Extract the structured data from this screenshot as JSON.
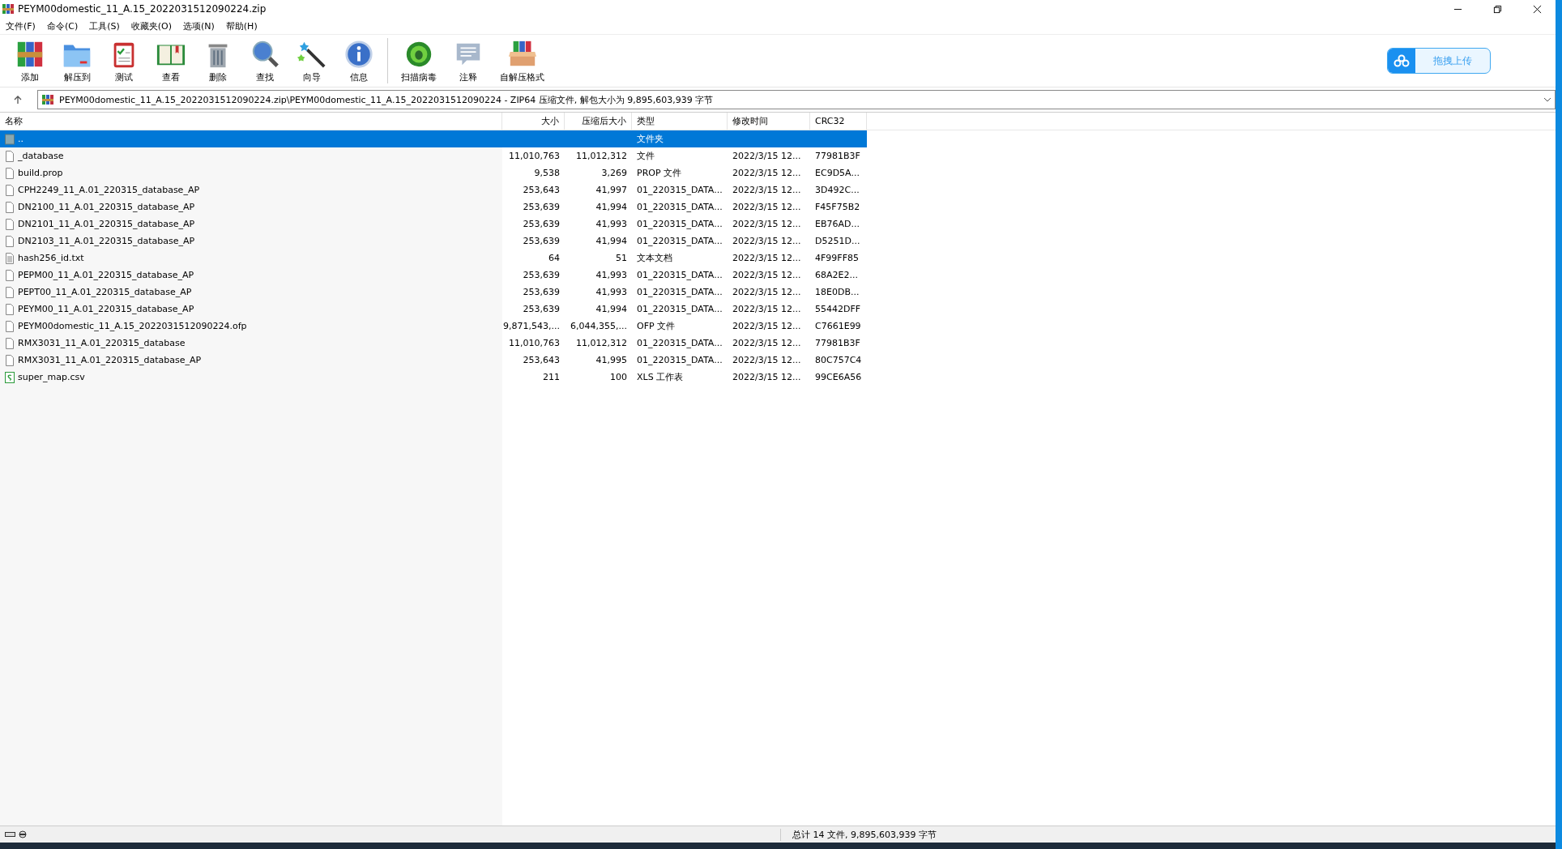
{
  "window": {
    "title": "PEYM00domestic_11_A.15_2022031512090224.zip"
  },
  "menu": [
    "文件(F)",
    "命令(C)",
    "工具(S)",
    "收藏夹(O)",
    "选项(N)",
    "帮助(H)"
  ],
  "toolbar": [
    {
      "label": "添加",
      "kind": "add"
    },
    {
      "label": "解压到",
      "kind": "extract"
    },
    {
      "label": "测试",
      "kind": "test"
    },
    {
      "label": "查看",
      "kind": "view"
    },
    {
      "label": "删除",
      "kind": "delete"
    },
    {
      "label": "查找",
      "kind": "find"
    },
    {
      "label": "向导",
      "kind": "wizard"
    },
    {
      "label": "信息",
      "kind": "info"
    },
    {
      "label": "扫描病毒",
      "kind": "scan",
      "separator_before": true
    },
    {
      "label": "注释",
      "kind": "comment"
    },
    {
      "label": "自解压格式",
      "kind": "sfx"
    }
  ],
  "upload_button": {
    "label": "拖拽上传"
  },
  "address": {
    "path": "PEYM00domestic_11_A.15_2022031512090224.zip\\PEYM00domestic_11_A.15_2022031512090224 - ZIP64 压缩文件, 解包大小为 9,895,603,939 字节"
  },
  "table": {
    "columns": [
      "名称",
      "大小",
      "压缩后大小",
      "类型",
      "修改时间",
      "CRC32"
    ],
    "rows": [
      {
        "kind": "parent",
        "name": "..",
        "size": "",
        "packed": "",
        "type": "文件夹",
        "modified": "",
        "crc": "",
        "selected": true
      },
      {
        "kind": "file",
        "name": "_database",
        "size": "11,010,763",
        "packed": "11,012,312",
        "type": "文件",
        "modified": "2022/3/15 12...",
        "crc": "77981B3F",
        "selected": false
      },
      {
        "kind": "file",
        "name": "build.prop",
        "size": "9,538",
        "packed": "3,269",
        "type": "PROP 文件",
        "modified": "2022/3/15 12...",
        "crc": "EC9D5A...",
        "selected": false
      },
      {
        "kind": "file",
        "name": "CPH2249_11_A.01_220315_database_AP",
        "size": "253,643",
        "packed": "41,997",
        "type": "01_220315_DATA...",
        "modified": "2022/3/15 12...",
        "crc": "3D492C...",
        "selected": false
      },
      {
        "kind": "file",
        "name": "DN2100_11_A.01_220315_database_AP",
        "size": "253,639",
        "packed": "41,994",
        "type": "01_220315_DATA...",
        "modified": "2022/3/15 12...",
        "crc": "F45F75B2",
        "selected": false
      },
      {
        "kind": "file",
        "name": "DN2101_11_A.01_220315_database_AP",
        "size": "253,639",
        "packed": "41,993",
        "type": "01_220315_DATA...",
        "modified": "2022/3/15 12...",
        "crc": "EB76AD...",
        "selected": false
      },
      {
        "kind": "file",
        "name": "DN2103_11_A.01_220315_database_AP",
        "size": "253,639",
        "packed": "41,994",
        "type": "01_220315_DATA...",
        "modified": "2022/3/15 12...",
        "crc": "D5251D...",
        "selected": false
      },
      {
        "kind": "text",
        "name": "hash256_id.txt",
        "size": "64",
        "packed": "51",
        "type": "文本文档",
        "modified": "2022/3/15 12...",
        "crc": "4F99FF85",
        "selected": false
      },
      {
        "kind": "file",
        "name": "PEPM00_11_A.01_220315_database_AP",
        "size": "253,639",
        "packed": "41,993",
        "type": "01_220315_DATA...",
        "modified": "2022/3/15 12...",
        "crc": "68A2E2...",
        "selected": false
      },
      {
        "kind": "file",
        "name": "PEPT00_11_A.01_220315_database_AP",
        "size": "253,639",
        "packed": "41,993",
        "type": "01_220315_DATA...",
        "modified": "2022/3/15 12...",
        "crc": "18E0DB...",
        "selected": false
      },
      {
        "kind": "file",
        "name": "PEYM00_11_A.01_220315_database_AP",
        "size": "253,639",
        "packed": "41,994",
        "type": "01_220315_DATA...",
        "modified": "2022/3/15 12...",
        "crc": "55442DFF",
        "selected": false
      },
      {
        "kind": "file",
        "name": "PEYM00domestic_11_A.15_2022031512090224.ofp",
        "size": "9,871,543,...",
        "packed": "6,044,355,...",
        "type": "OFP 文件",
        "modified": "2022/3/15 12...",
        "crc": "C7661E99",
        "selected": false
      },
      {
        "kind": "file",
        "name": "RMX3031_11_A.01_220315_database",
        "size": "11,010,763",
        "packed": "11,012,312",
        "type": "01_220315_DATA...",
        "modified": "2022/3/15 12...",
        "crc": "77981B3F",
        "selected": false
      },
      {
        "kind": "file",
        "name": "RMX3031_11_A.01_220315_database_AP",
        "size": "253,643",
        "packed": "41,995",
        "type": "01_220315_DATA...",
        "modified": "2022/3/15 12...",
        "crc": "80C757C4",
        "selected": false
      },
      {
        "kind": "sheet",
        "name": "super_map.csv",
        "size": "211",
        "packed": "100",
        "type": "XLS 工作表",
        "modified": "2022/3/15 12...",
        "crc": "99CE6A56",
        "selected": false
      }
    ]
  },
  "status_bar": {
    "summary": "总计 14 文件, 9,895,603,939 字节"
  }
}
